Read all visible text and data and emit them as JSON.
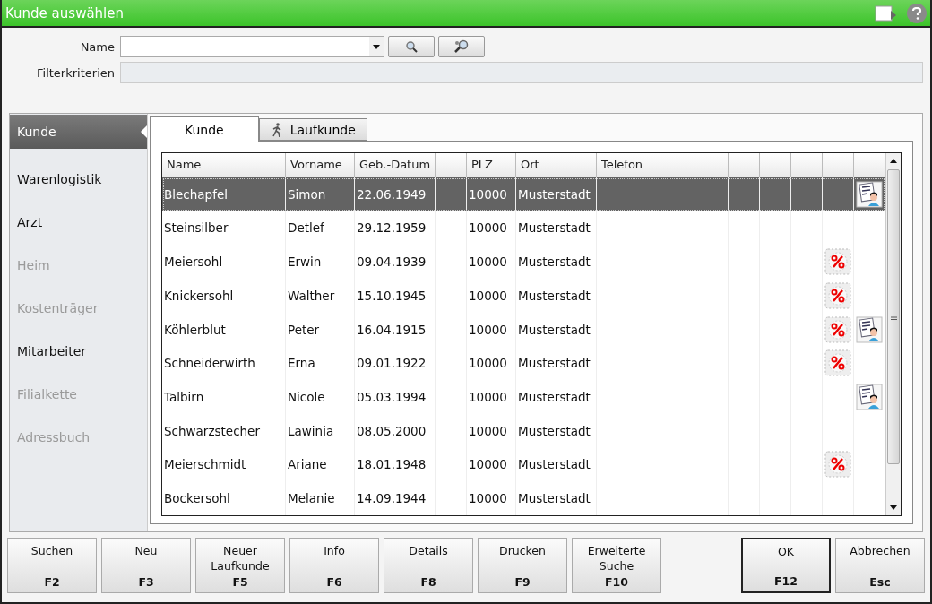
{
  "window": {
    "title": "Kunde auswählen"
  },
  "form": {
    "name_label": "Name",
    "filter_label": "Filterkriterien"
  },
  "sidebar": {
    "items": [
      {
        "label": "Kunde",
        "selected": true,
        "disabled": false
      },
      {
        "label": "Warenlogistik",
        "selected": false,
        "disabled": false
      },
      {
        "label": "Arzt",
        "selected": false,
        "disabled": false
      },
      {
        "label": "Heim",
        "selected": false,
        "disabled": true
      },
      {
        "label": "Kostenträger",
        "selected": false,
        "disabled": true
      },
      {
        "label": "Mitarbeiter",
        "selected": false,
        "disabled": false
      },
      {
        "label": "Filialkette",
        "selected": false,
        "disabled": true
      },
      {
        "label": "Adressbuch",
        "selected": false,
        "disabled": true
      }
    ]
  },
  "tabs": [
    {
      "label": "Kunde",
      "selected": true,
      "icon": false
    },
    {
      "label": "Laufkunde",
      "selected": false,
      "icon": true
    }
  ],
  "table": {
    "columns": [
      "Name",
      "Vorname",
      "Geb.-Datum",
      "PLZ",
      "Ort",
      "Telefon"
    ],
    "rows": [
      {
        "cells": [
          "Blechapfel",
          "Simon",
          "22.06.1949",
          "10000",
          "Musterstadt",
          ""
        ],
        "selected": true,
        "discount": false,
        "contact_card": true
      },
      {
        "cells": [
          "Steinsilber",
          "Detlef",
          "29.12.1959",
          "10000",
          "Musterstadt",
          ""
        ],
        "selected": false,
        "discount": false,
        "contact_card": false
      },
      {
        "cells": [
          "Meiersohl",
          "Erwin",
          "09.04.1939",
          "10000",
          "Musterstadt",
          ""
        ],
        "selected": false,
        "discount": true,
        "contact_card": false
      },
      {
        "cells": [
          "Knickersohl",
          "Walther",
          "15.10.1945",
          "10000",
          "Musterstadt",
          ""
        ],
        "selected": false,
        "discount": true,
        "contact_card": false
      },
      {
        "cells": [
          "Köhlerblut",
          "Peter",
          "16.04.1915",
          "10000",
          "Musterstadt",
          ""
        ],
        "selected": false,
        "discount": true,
        "contact_card": true
      },
      {
        "cells": [
          "Schneiderwirth",
          "Erna",
          "09.01.1922",
          "10000",
          "Musterstadt",
          ""
        ],
        "selected": false,
        "discount": true,
        "contact_card": false
      },
      {
        "cells": [
          "Talbirn",
          "Nicole",
          "05.03.1994",
          "10000",
          "Musterstadt",
          ""
        ],
        "selected": false,
        "discount": false,
        "contact_card": true
      },
      {
        "cells": [
          "Schwarzstecher",
          "Lawinia",
          "08.05.2000",
          "10000",
          "Musterstadt",
          ""
        ],
        "selected": false,
        "discount": false,
        "contact_card": false
      },
      {
        "cells": [
          "Meierschmidt",
          "Ariane",
          "18.01.1948",
          "10000",
          "Musterstadt",
          ""
        ],
        "selected": false,
        "discount": true,
        "contact_card": false
      },
      {
        "cells": [
          "Bockersohl",
          "Melanie",
          "14.09.1944",
          "10000",
          "Musterstadt",
          ""
        ],
        "selected": false,
        "discount": false,
        "contact_card": false
      }
    ]
  },
  "buttons": [
    {
      "label": "Suchen",
      "key": "F2",
      "default": false
    },
    {
      "label": "Neu",
      "key": "F3",
      "default": false
    },
    {
      "label": "Neuer Laufkunde",
      "key": "F5",
      "default": false
    },
    {
      "label": "Info",
      "key": "F6",
      "default": false
    },
    {
      "label": "Details",
      "key": "F8",
      "default": false
    },
    {
      "label": "Drucken",
      "key": "F9",
      "default": false
    },
    {
      "label": "Erweiterte Suche",
      "key": "F10",
      "default": false
    },
    {
      "label": "OK",
      "key": "F12",
      "default": true
    },
    {
      "label": "Abbrechen",
      "key": "Esc",
      "default": false
    }
  ]
}
